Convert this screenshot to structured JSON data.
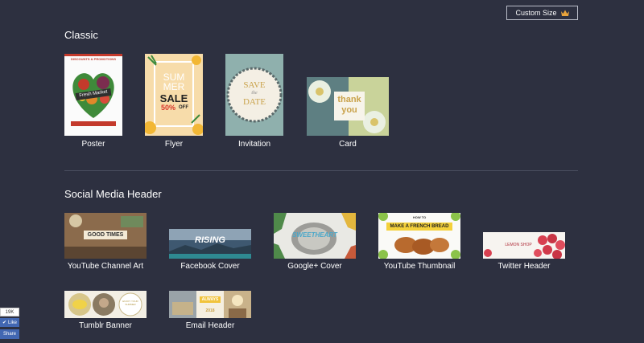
{
  "header": {
    "custom_size_label": "Custom Size"
  },
  "sections": {
    "classic": {
      "title": "Classic",
      "items": [
        {
          "label": "Poster",
          "text1": "DISCOUNTS & PROMOTIONS",
          "text2": "Fresh Market"
        },
        {
          "label": "Flyer",
          "text1": "SUM",
          "text2": "MER",
          "text3": "SALE",
          "text4": "50%",
          "text5": "OFF"
        },
        {
          "label": "Invitation",
          "text1": "SAVE",
          "text2": "the",
          "text3": "DATE"
        },
        {
          "label": "Card",
          "text1": "thank",
          "text2": "you"
        }
      ]
    },
    "social": {
      "title": "Social Media Header",
      "items": [
        {
          "label": "YouTube Channel Art",
          "text1": "GOOD TIMES"
        },
        {
          "label": "Facebook Cover",
          "text1": "RISING"
        },
        {
          "label": "Google+ Cover",
          "text1": "SWEETHEART"
        },
        {
          "label": "YouTube Thumbnail",
          "text1": "HOW TO",
          "text2": "MAKE A FRENCH BREAD"
        },
        {
          "label": "Twitter Header",
          "text1": "LEMON SHOP"
        },
        {
          "label": "Tumblr Banner",
          "text1": "ENJOY YOUR SUMMER"
        },
        {
          "label": "Email Header",
          "text1": "ALWAYS",
          "text2": "2018"
        }
      ]
    }
  },
  "social_widget": {
    "count": "19K",
    "like": "Like",
    "share": "Share"
  },
  "colors": {
    "background": "#2d3040",
    "accent_crown": "#e8a33b"
  }
}
